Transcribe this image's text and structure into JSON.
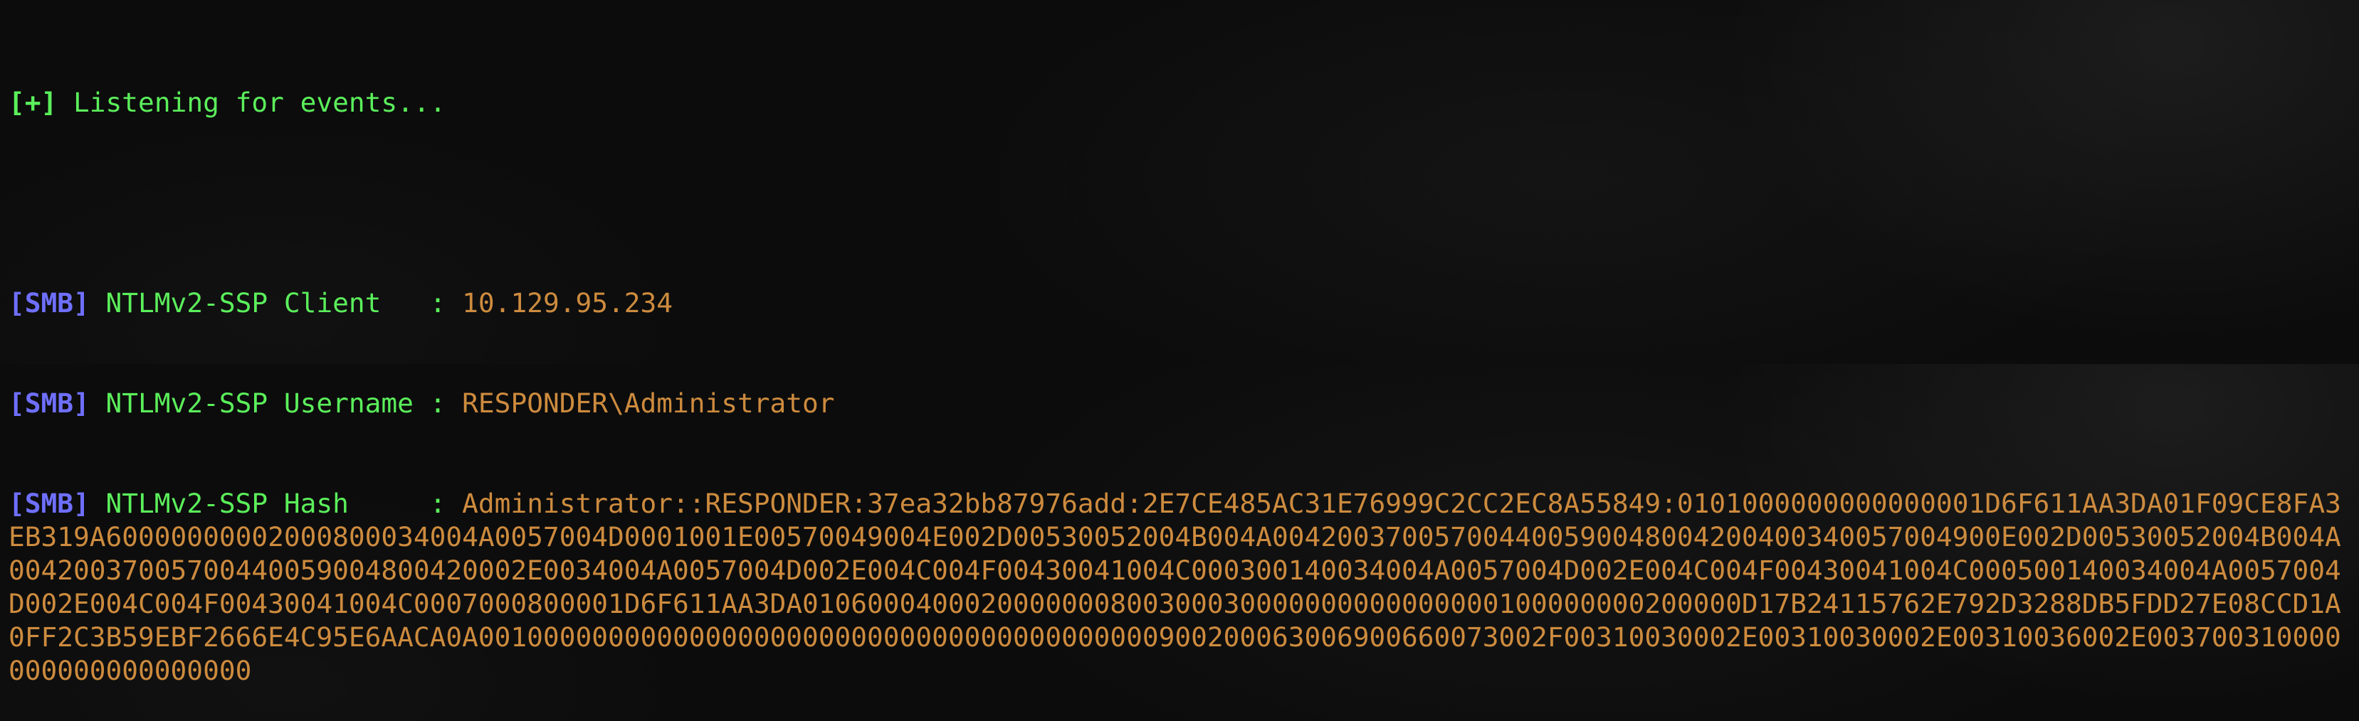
{
  "status_line": {
    "tag": "[+]",
    "text": " Listening for events..."
  },
  "events": [
    {
      "tag": "[SMB]",
      "label": " NTLMv2-SSP Client   : ",
      "value": "10.129.95.234"
    },
    {
      "tag": "[SMB]",
      "label": " NTLMv2-SSP Username : ",
      "value": "RESPONDER\\Administrator"
    },
    {
      "tag": "[SMB]",
      "label": " NTLMv2-SSP Hash     : ",
      "value": "Administrator::RESPONDER:37ea32bb87976add:2E7CE485AC31E76999C2CC2EC8A55849:0101000000000000001D6F611AA3DA01F09CE8FA3EB319A60000000002000800034004A0057004D0001001E00570049004E002D00530052004B004A004200370057004400590048004200400340057004900E002D00530052004B004A00420037005700440059004800420002E0034004A0057004D002E004C004F00430041004C000300140034004A0057004D002E004C004F00430041004C000500140034004A0057004D002E004C004F00430041004C0007000800001D6F611AA3DA0106000400020000000800300030000000000000000100000000200000D17B24115762E792D3288DB5FDD27E08CCD1A0FF2C3B59EBF2666E4C95E6AACA0A001000000000000000000000000000000000000000900200063006900660073002F00310030002E00310030002E00310036002E003700310000000000000000000"
    }
  ],
  "colors": {
    "background": "#0c0c0c",
    "green": "#5bef5b",
    "blue": "#6f6fff",
    "orange": "#cd8b3e"
  }
}
